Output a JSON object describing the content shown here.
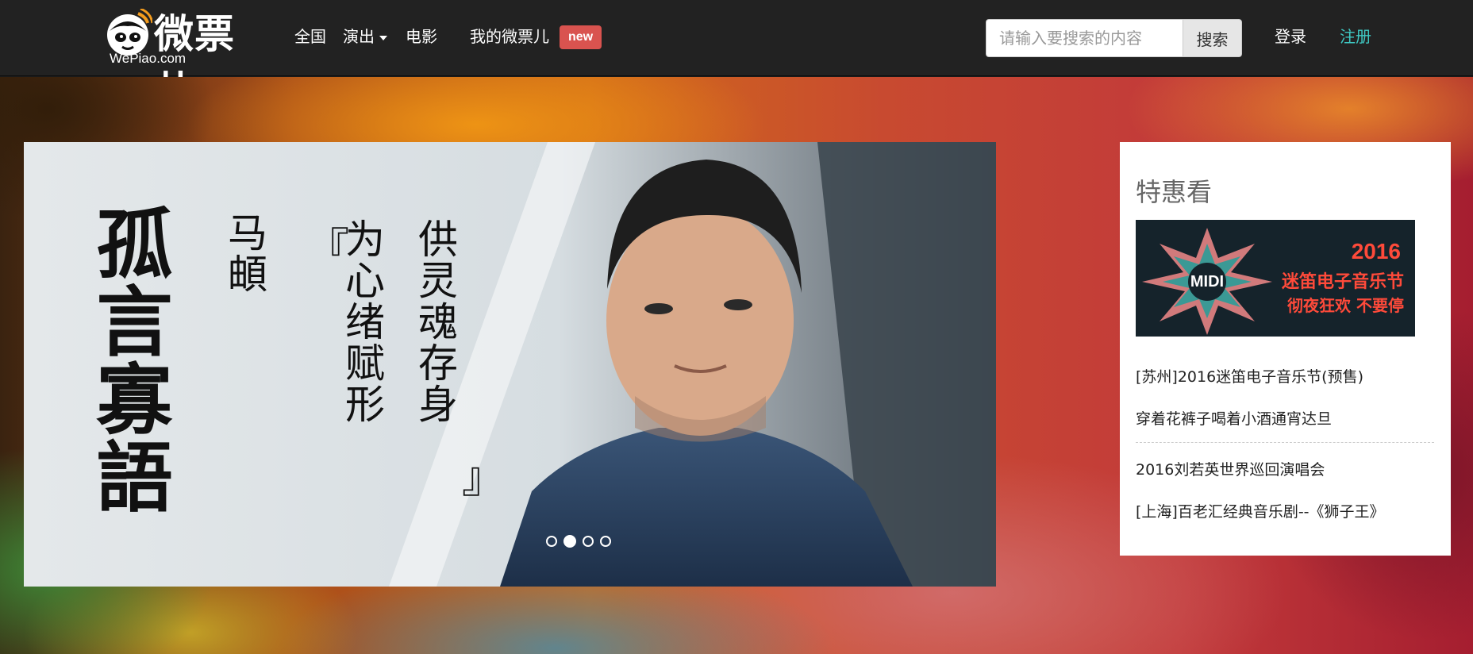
{
  "brand": {
    "logo_text": "微票儿",
    "logo_sub": "WePiao.com"
  },
  "nav": {
    "items": [
      {
        "label": "全国"
      },
      {
        "label": "演出"
      },
      {
        "label": "电影"
      },
      {
        "label": "我的微票儿"
      }
    ],
    "new_badge": "new"
  },
  "search": {
    "placeholder": "请输入要搜索的内容",
    "value": "",
    "button_label": "搜索"
  },
  "auth": {
    "login_label": "登录",
    "register_label": "注册"
  },
  "carousel": {
    "slide": {
      "title_chars": [
        "孤",
        "言",
        "寡",
        "語"
      ],
      "artist": "马頔",
      "line1": "为心绪赋形",
      "line2": "供灵魂存身",
      "open_bracket": "『",
      "close_bracket": "』"
    },
    "total_slides": 4,
    "active_index": 1
  },
  "sidebar": {
    "title": "特惠看",
    "banner": {
      "year": "2016",
      "title": "迷笛电子音乐节",
      "subtitle": "彻夜狂欢 不要停",
      "badge_text": "MIDI"
    },
    "links": [
      "[苏州]2016迷笛电子音乐节(预售)",
      "穿着花裤子喝着小酒通宵达旦",
      "2016刘若英世界巡回演唱会",
      "[上海]百老汇经典音乐剧--《狮子王》"
    ]
  },
  "colors": {
    "nav_bg": "#222222",
    "register": "#3fc9c4",
    "badge_new": "#d9534f",
    "banner_red": "#ff4a3a"
  }
}
